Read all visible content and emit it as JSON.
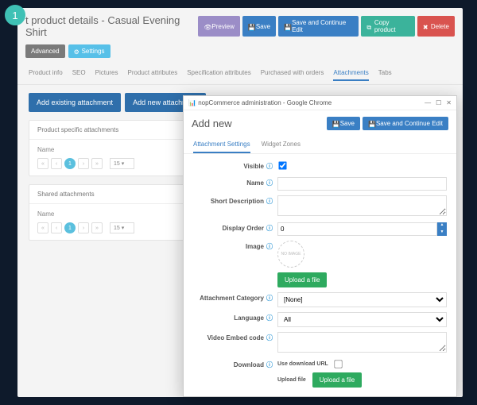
{
  "badge": "1",
  "page": {
    "title": "t product details - Casual Evening Shirt"
  },
  "topbtns": {
    "preview": "Preview",
    "save": "Save",
    "savecont": "Save and Continue Edit",
    "copy": "Copy product",
    "delete": "Delete"
  },
  "subbtns": {
    "advanced": "Advanced",
    "settings": "Settings"
  },
  "maintabs": [
    "Product info",
    "SEO",
    "Pictures",
    "Product attributes",
    "Specification attributes",
    "Purchased with orders",
    "Attachments",
    "Tabs"
  ],
  "maintabs_active": 6,
  "addbtns": {
    "existing": "Add existing attachment",
    "new": "Add new attachment"
  },
  "cards": {
    "specific": {
      "title": "Product specific attachments",
      "col": "Name"
    },
    "shared": {
      "title": "Shared attachments",
      "col": "Name"
    }
  },
  "pager": {
    "page": "1",
    "size": "15"
  },
  "modal": {
    "wintitle": "nopCommerce administration - Google Chrome",
    "heading": "Add new",
    "save": "Save",
    "savecont": "Save and Continue Edit",
    "tabs": [
      "Attachment Settings",
      "Widget Zones"
    ],
    "tabs_active": 0,
    "fields": {
      "visible": "Visible",
      "name": "Name",
      "shortdesc": "Short Description",
      "displayorder": "Display Order",
      "displayorder_val": "0",
      "image": "Image",
      "noimage": "NO IMAGE",
      "upload": "Upload a file",
      "attcat": "Attachment Category",
      "attcat_val": "[None]",
      "language": "Language",
      "language_val": "All",
      "video": "Video Embed code",
      "download": "Download",
      "usedl": "Use download URL",
      "uploadfile": "Upload file"
    }
  }
}
